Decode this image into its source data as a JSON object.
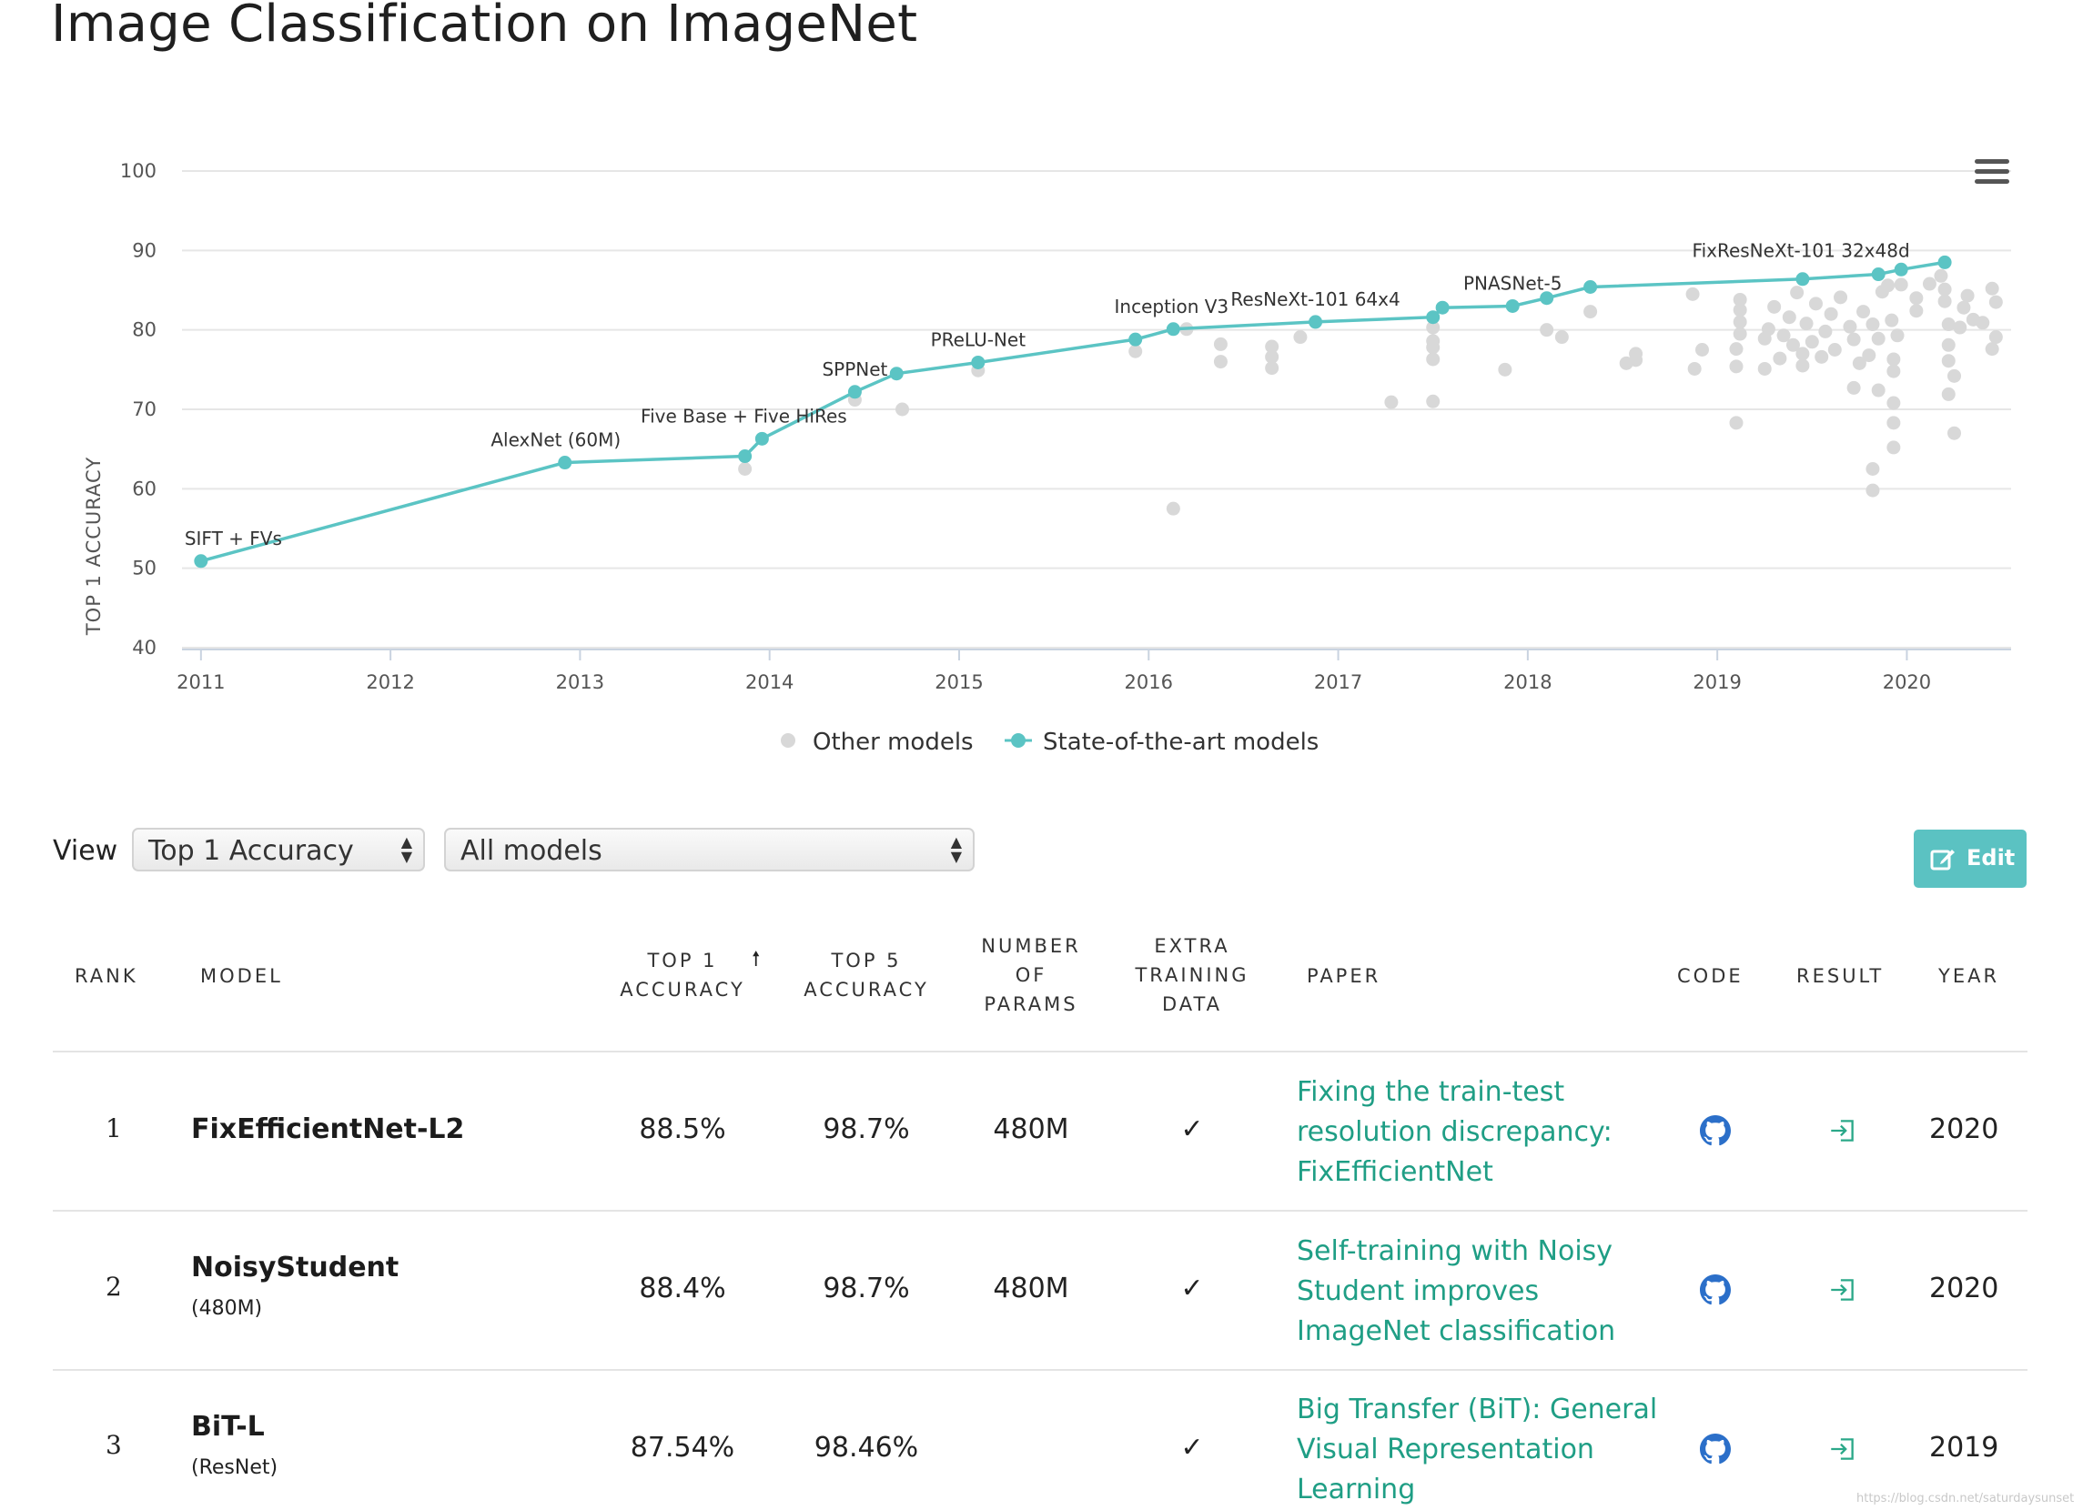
{
  "page": {
    "title": "Image Classification on ImageNet"
  },
  "chart_data": {
    "type": "scatter",
    "ylabel": "TOP 1 ACCURACY",
    "xlabel": "",
    "ylim": [
      40,
      100
    ],
    "yticks": [
      "40",
      "50",
      "60",
      "70",
      "80",
      "90",
      "100"
    ],
    "xlim": [
      2010.9,
      2020.55
    ],
    "xticks": [
      "2011",
      "2012",
      "2013",
      "2014",
      "2015",
      "2016",
      "2017",
      "2018",
      "2019",
      "2020"
    ],
    "grid": true,
    "legend_position": "bottom",
    "colors": {
      "sota": "#5bc4c4",
      "other": "#d8d8d8",
      "grid": "#e6e6e6",
      "axis": "#c9d3e0"
    },
    "series": [
      {
        "name": "State-of-the-art models",
        "points": [
          {
            "x": 2011.0,
            "y": 50.9
          },
          {
            "x": 2012.92,
            "y": 63.3
          },
          {
            "x": 2013.87,
            "y": 64.1
          },
          {
            "x": 2013.96,
            "y": 66.3
          },
          {
            "x": 2014.45,
            "y": 72.2
          },
          {
            "x": 2014.67,
            "y": 74.5
          },
          {
            "x": 2015.1,
            "y": 75.9
          },
          {
            "x": 2015.93,
            "y": 78.8
          },
          {
            "x": 2016.13,
            "y": 80.1
          },
          {
            "x": 2016.88,
            "y": 81.0
          },
          {
            "x": 2017.5,
            "y": 81.6
          },
          {
            "x": 2017.55,
            "y": 82.8
          },
          {
            "x": 2017.92,
            "y": 83.0
          },
          {
            "x": 2018.1,
            "y": 84.0
          },
          {
            "x": 2018.33,
            "y": 85.4
          },
          {
            "x": 2019.45,
            "y": 86.4
          },
          {
            "x": 2019.85,
            "y": 87.0
          },
          {
            "x": 2019.97,
            "y": 87.6
          },
          {
            "x": 2020.2,
            "y": 88.5
          }
        ]
      },
      {
        "name": "Other models",
        "points": [
          {
            "x": 2013.87,
            "y": 62.5
          },
          {
            "x": 2014.45,
            "y": 71.2
          },
          {
            "x": 2014.7,
            "y": 70.0
          },
          {
            "x": 2015.1,
            "y": 74.9
          },
          {
            "x": 2015.93,
            "y": 77.3
          },
          {
            "x": 2016.13,
            "y": 57.5
          },
          {
            "x": 2016.2,
            "y": 80.1
          },
          {
            "x": 2016.38,
            "y": 78.2
          },
          {
            "x": 2016.38,
            "y": 76.0
          },
          {
            "x": 2016.65,
            "y": 77.9
          },
          {
            "x": 2016.65,
            "y": 76.6
          },
          {
            "x": 2016.65,
            "y": 75.2
          },
          {
            "x": 2016.8,
            "y": 79.1
          },
          {
            "x": 2017.28,
            "y": 70.9
          },
          {
            "x": 2017.5,
            "y": 71.0
          },
          {
            "x": 2017.5,
            "y": 80.3
          },
          {
            "x": 2017.5,
            "y": 78.6
          },
          {
            "x": 2017.5,
            "y": 77.8
          },
          {
            "x": 2017.5,
            "y": 76.3
          },
          {
            "x": 2017.88,
            "y": 75.0
          },
          {
            "x": 2018.1,
            "y": 80.0
          },
          {
            "x": 2018.18,
            "y": 79.1
          },
          {
            "x": 2018.33,
            "y": 82.3
          },
          {
            "x": 2018.52,
            "y": 75.8
          },
          {
            "x": 2018.57,
            "y": 76.2
          },
          {
            "x": 2018.57,
            "y": 77.0
          },
          {
            "x": 2018.87,
            "y": 84.5
          },
          {
            "x": 2018.88,
            "y": 75.1
          },
          {
            "x": 2018.92,
            "y": 77.5
          },
          {
            "x": 2019.1,
            "y": 68.3
          },
          {
            "x": 2019.1,
            "y": 75.4
          },
          {
            "x": 2019.1,
            "y": 77.6
          },
          {
            "x": 2019.12,
            "y": 79.5
          },
          {
            "x": 2019.12,
            "y": 81.0
          },
          {
            "x": 2019.12,
            "y": 82.5
          },
          {
            "x": 2019.12,
            "y": 83.8
          },
          {
            "x": 2019.25,
            "y": 75.1
          },
          {
            "x": 2019.25,
            "y": 78.9
          },
          {
            "x": 2019.27,
            "y": 80.1
          },
          {
            "x": 2019.3,
            "y": 82.9
          },
          {
            "x": 2019.33,
            "y": 76.4
          },
          {
            "x": 2019.35,
            "y": 79.3
          },
          {
            "x": 2019.38,
            "y": 81.6
          },
          {
            "x": 2019.4,
            "y": 78.1
          },
          {
            "x": 2019.42,
            "y": 84.7
          },
          {
            "x": 2019.45,
            "y": 75.5
          },
          {
            "x": 2019.45,
            "y": 77.0
          },
          {
            "x": 2019.47,
            "y": 80.8
          },
          {
            "x": 2019.5,
            "y": 78.5
          },
          {
            "x": 2019.52,
            "y": 83.3
          },
          {
            "x": 2019.55,
            "y": 76.6
          },
          {
            "x": 2019.57,
            "y": 79.8
          },
          {
            "x": 2019.6,
            "y": 82.0
          },
          {
            "x": 2019.62,
            "y": 77.5
          },
          {
            "x": 2019.65,
            "y": 84.1
          },
          {
            "x": 2019.7,
            "y": 80.4
          },
          {
            "x": 2019.72,
            "y": 72.7
          },
          {
            "x": 2019.72,
            "y": 78.8
          },
          {
            "x": 2019.75,
            "y": 75.8
          },
          {
            "x": 2019.77,
            "y": 82.3
          },
          {
            "x": 2019.8,
            "y": 76.8
          },
          {
            "x": 2019.82,
            "y": 80.7
          },
          {
            "x": 2019.82,
            "y": 62.5
          },
          {
            "x": 2019.82,
            "y": 59.8
          },
          {
            "x": 2019.85,
            "y": 72.4
          },
          {
            "x": 2019.85,
            "y": 78.9
          },
          {
            "x": 2019.87,
            "y": 84.8
          },
          {
            "x": 2019.9,
            "y": 85.6
          },
          {
            "x": 2019.92,
            "y": 81.2
          },
          {
            "x": 2019.93,
            "y": 76.3
          },
          {
            "x": 2019.93,
            "y": 74.8
          },
          {
            "x": 2019.93,
            "y": 70.8
          },
          {
            "x": 2019.93,
            "y": 68.3
          },
          {
            "x": 2019.93,
            "y": 65.2
          },
          {
            "x": 2019.95,
            "y": 79.3
          },
          {
            "x": 2019.97,
            "y": 85.7
          },
          {
            "x": 2020.05,
            "y": 84.0
          },
          {
            "x": 2020.05,
            "y": 82.4
          },
          {
            "x": 2020.12,
            "y": 85.8
          },
          {
            "x": 2020.18,
            "y": 86.8
          },
          {
            "x": 2020.2,
            "y": 85.1
          },
          {
            "x": 2020.2,
            "y": 83.6
          },
          {
            "x": 2020.22,
            "y": 80.7
          },
          {
            "x": 2020.22,
            "y": 78.1
          },
          {
            "x": 2020.22,
            "y": 76.1
          },
          {
            "x": 2020.22,
            "y": 71.9
          },
          {
            "x": 2020.25,
            "y": 67.0
          },
          {
            "x": 2020.25,
            "y": 74.2
          },
          {
            "x": 2020.28,
            "y": 80.3
          },
          {
            "x": 2020.3,
            "y": 82.8
          },
          {
            "x": 2020.32,
            "y": 84.3
          },
          {
            "x": 2020.35,
            "y": 81.3
          },
          {
            "x": 2020.4,
            "y": 80.9
          },
          {
            "x": 2020.45,
            "y": 77.6
          },
          {
            "x": 2020.45,
            "y": 85.2
          },
          {
            "x": 2020.47,
            "y": 83.5
          },
          {
            "x": 2020.47,
            "y": 79.1
          }
        ]
      }
    ],
    "annotations": [
      {
        "text": "SIFT + FVs",
        "x": 2011.0,
        "y": 50.9
      },
      {
        "text": "AlexNet   (60M)",
        "x": 2012.92,
        "y": 63.3
      },
      {
        "text": "Five Base + Five HiRes",
        "x": 2013.96,
        "y": 66.3
      },
      {
        "text": "SPPNet",
        "x": 2014.45,
        "y": 72.2
      },
      {
        "text": "PReLU-Net",
        "x": 2015.1,
        "y": 75.9
      },
      {
        "text": "Inception V3",
        "x": 2016.13,
        "y": 80.1
      },
      {
        "text": "ResNeXt-101 64x4",
        "x": 2016.88,
        "y": 81.0
      },
      {
        "text": "PNASNet-5",
        "x": 2017.92,
        "y": 83.0
      },
      {
        "text": "FixResNeXt-101 32x48d",
        "x": 2020.2,
        "y": 88.5
      }
    ]
  },
  "legend": {
    "other": "Other models",
    "sota": "State-of-the-art models"
  },
  "controls": {
    "view_label": "View",
    "metric_select": "Top 1 Accuracy",
    "filter_select": "All models",
    "edit_label": "Edit",
    "sort_indicator": "🠕"
  },
  "table": {
    "headers": {
      "rank": "RANK",
      "model": "MODEL",
      "top1": [
        "TOP 1",
        "ACCURACY"
      ],
      "top5": [
        "TOP 5",
        "ACCURACY"
      ],
      "params": [
        "NUMBER",
        "OF",
        "PARAMS"
      ],
      "extra": [
        "EXTRA",
        "TRAINING",
        "DATA"
      ],
      "paper": "PAPER",
      "code": "CODE",
      "result": "RESULT",
      "year": "YEAR"
    },
    "rows": [
      {
        "rank": "1",
        "model": "FixEfficientNet-L2",
        "model_sub": "",
        "top1": "88.5%",
        "top5": "98.7%",
        "params": "480M",
        "extra": "✓",
        "paper": [
          "Fixing the train-test",
          "resolution discrepancy:",
          "FixEfficientNet"
        ],
        "year": "2020"
      },
      {
        "rank": "2",
        "model": "NoisyStudent",
        "model_sub": "(480M)",
        "top1": "88.4%",
        "top5": "98.7%",
        "params": "480M",
        "extra": "✓",
        "paper": [
          "Self-training with Noisy",
          "Student improves",
          "ImageNet classification"
        ],
        "year": "2020"
      },
      {
        "rank": "3",
        "model": "BiT-L",
        "model_sub": "(ResNet)",
        "top1": "87.54%",
        "top5": "98.46%",
        "params": "",
        "extra": "✓",
        "paper": [
          "Big Transfer (BiT): General",
          "Visual Representation",
          "Learning"
        ],
        "year": "2019"
      }
    ]
  },
  "watermark": "https://blog.csdn.net/saturdaysunset"
}
